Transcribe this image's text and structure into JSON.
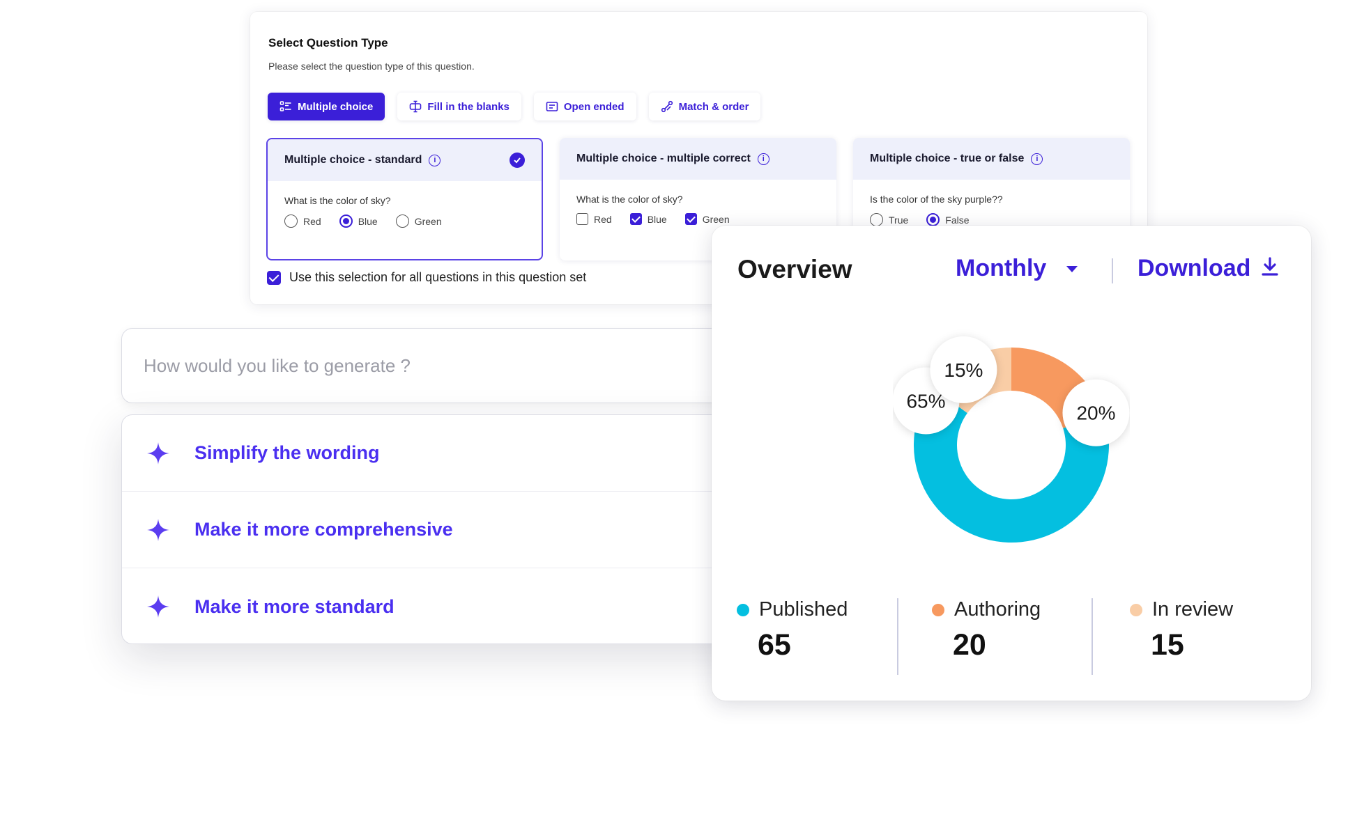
{
  "question_type": {
    "title": "Select Question Type",
    "subtitle": "Please select the question type of this question.",
    "types": [
      {
        "label": "Multiple choice",
        "icon": "list-icon",
        "active": true
      },
      {
        "label": "Fill in the blanks",
        "icon": "text-cursor-icon",
        "active": false
      },
      {
        "label": "Open ended",
        "icon": "textbox-icon",
        "active": false
      },
      {
        "label": "Match & order",
        "icon": "connect-icon",
        "active": false
      }
    ],
    "options": [
      {
        "title": "Multiple choice - standard",
        "question": "What is the color of sky?",
        "choices": [
          "Red",
          "Blue",
          "Green"
        ],
        "selected": [
          "Blue"
        ]
      },
      {
        "title": "Multiple choice - multiple correct",
        "question": "What is the color of sky?",
        "choices": [
          "Red",
          "Blue",
          "Green"
        ],
        "selected": [
          "Blue",
          "Green"
        ]
      },
      {
        "title": "Multiple choice - true or false",
        "question": "Is the color of the sky purple??",
        "choices": [
          "True",
          "False"
        ],
        "selected": [
          "False"
        ]
      }
    ],
    "use_all_label": "Use this selection for all questions in this question set",
    "use_all_checked": true
  },
  "generate": {
    "placeholder": "How would you like to generate ?",
    "suggestions": [
      "Simplify the wording",
      "Make it more comprehensive",
      "Make it more standard"
    ]
  },
  "overview": {
    "title": "Overview",
    "period": "Monthly",
    "download_label": "Download",
    "legend": [
      {
        "label": "Published",
        "value": "65",
        "color": "#04bfe0"
      },
      {
        "label": "Authoring",
        "value": "20",
        "color": "#f7995f"
      },
      {
        "label": "In review",
        "value": "15",
        "color": "#f9cda6"
      }
    ]
  },
  "chart_data": {
    "type": "pie",
    "categories": [
      "Published",
      "Authoring",
      "In review"
    ],
    "values": [
      65,
      20,
      15
    ],
    "labels": [
      "65%",
      "20%",
      "15%"
    ],
    "colors": [
      "#04bfe0",
      "#f7995f",
      "#f9cda6"
    ]
  },
  "colors": {
    "accent": "#3b1fd8",
    "suggestion_text": "#4a2ff0"
  }
}
